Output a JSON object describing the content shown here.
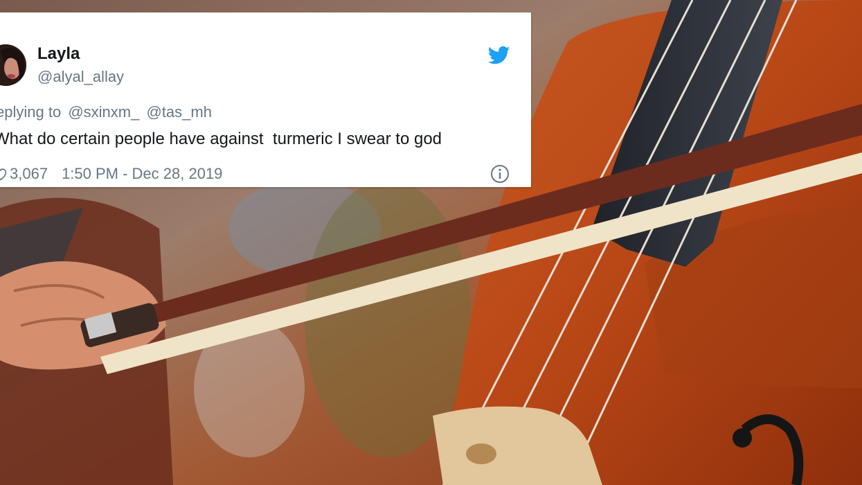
{
  "tweet": {
    "author_name": "Layla",
    "author_handle": "@alyal_allay",
    "reply_prefix": "eplying to",
    "mentions": [
      "@sxinxm_",
      "@tas_mh"
    ],
    "text": "What do certain people have against  turmeric I swear to god",
    "like_count": "3,067",
    "timestamp": "1:50 PM - Dec 28, 2019"
  },
  "icons": {
    "brand": "twitter-bird-icon",
    "like": "heart-icon",
    "info": "info-icon"
  },
  "colors": {
    "twitter_blue": "#1da1f2",
    "primary_text": "#14171a",
    "secondary_text": "#657786",
    "card_background": "#ffffff"
  }
}
